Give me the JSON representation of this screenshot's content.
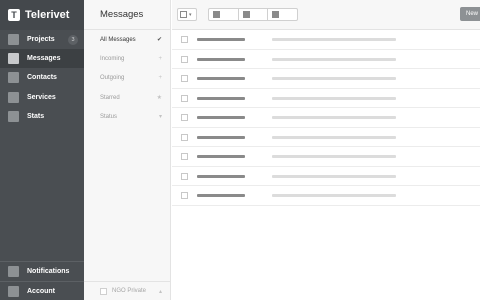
{
  "app": {
    "brand": "Telerivet",
    "logo_letter": "T"
  },
  "sidebar": {
    "items": [
      {
        "label": "Projects",
        "badge": "3",
        "active": false
      },
      {
        "label": "Messages",
        "active": true
      },
      {
        "label": "Contacts",
        "active": false
      },
      {
        "label": "Services",
        "active": false
      },
      {
        "label": "Stats",
        "active": false
      }
    ],
    "bottom_items": [
      {
        "label": "Notifications"
      },
      {
        "label": "Account"
      }
    ]
  },
  "header": {
    "title": "Messages",
    "new_label": "New"
  },
  "filters": {
    "items": [
      {
        "label": "All Messages",
        "icon": "check-icon",
        "glyph": "✔",
        "active": true
      },
      {
        "label": "Incoming",
        "icon": "plus-icon",
        "glyph": "+",
        "active": false
      },
      {
        "label": "Outgoing",
        "icon": "plus-icon",
        "glyph": "+",
        "active": false
      },
      {
        "label": "Starred",
        "icon": "star-icon",
        "glyph": "★",
        "active": false
      },
      {
        "label": "Status",
        "icon": "chevron-down-icon",
        "glyph": "▾",
        "active": false
      }
    ],
    "footer": {
      "label": "NGO Private",
      "glyph": "▴"
    }
  },
  "toolbar": {
    "select_caret": "▾"
  },
  "messages": {
    "row_count": 9
  },
  "colors": {
    "sidebar": "#4a4e52",
    "sidebar_active": "#3c4043",
    "accent_button": "#8d9194"
  }
}
